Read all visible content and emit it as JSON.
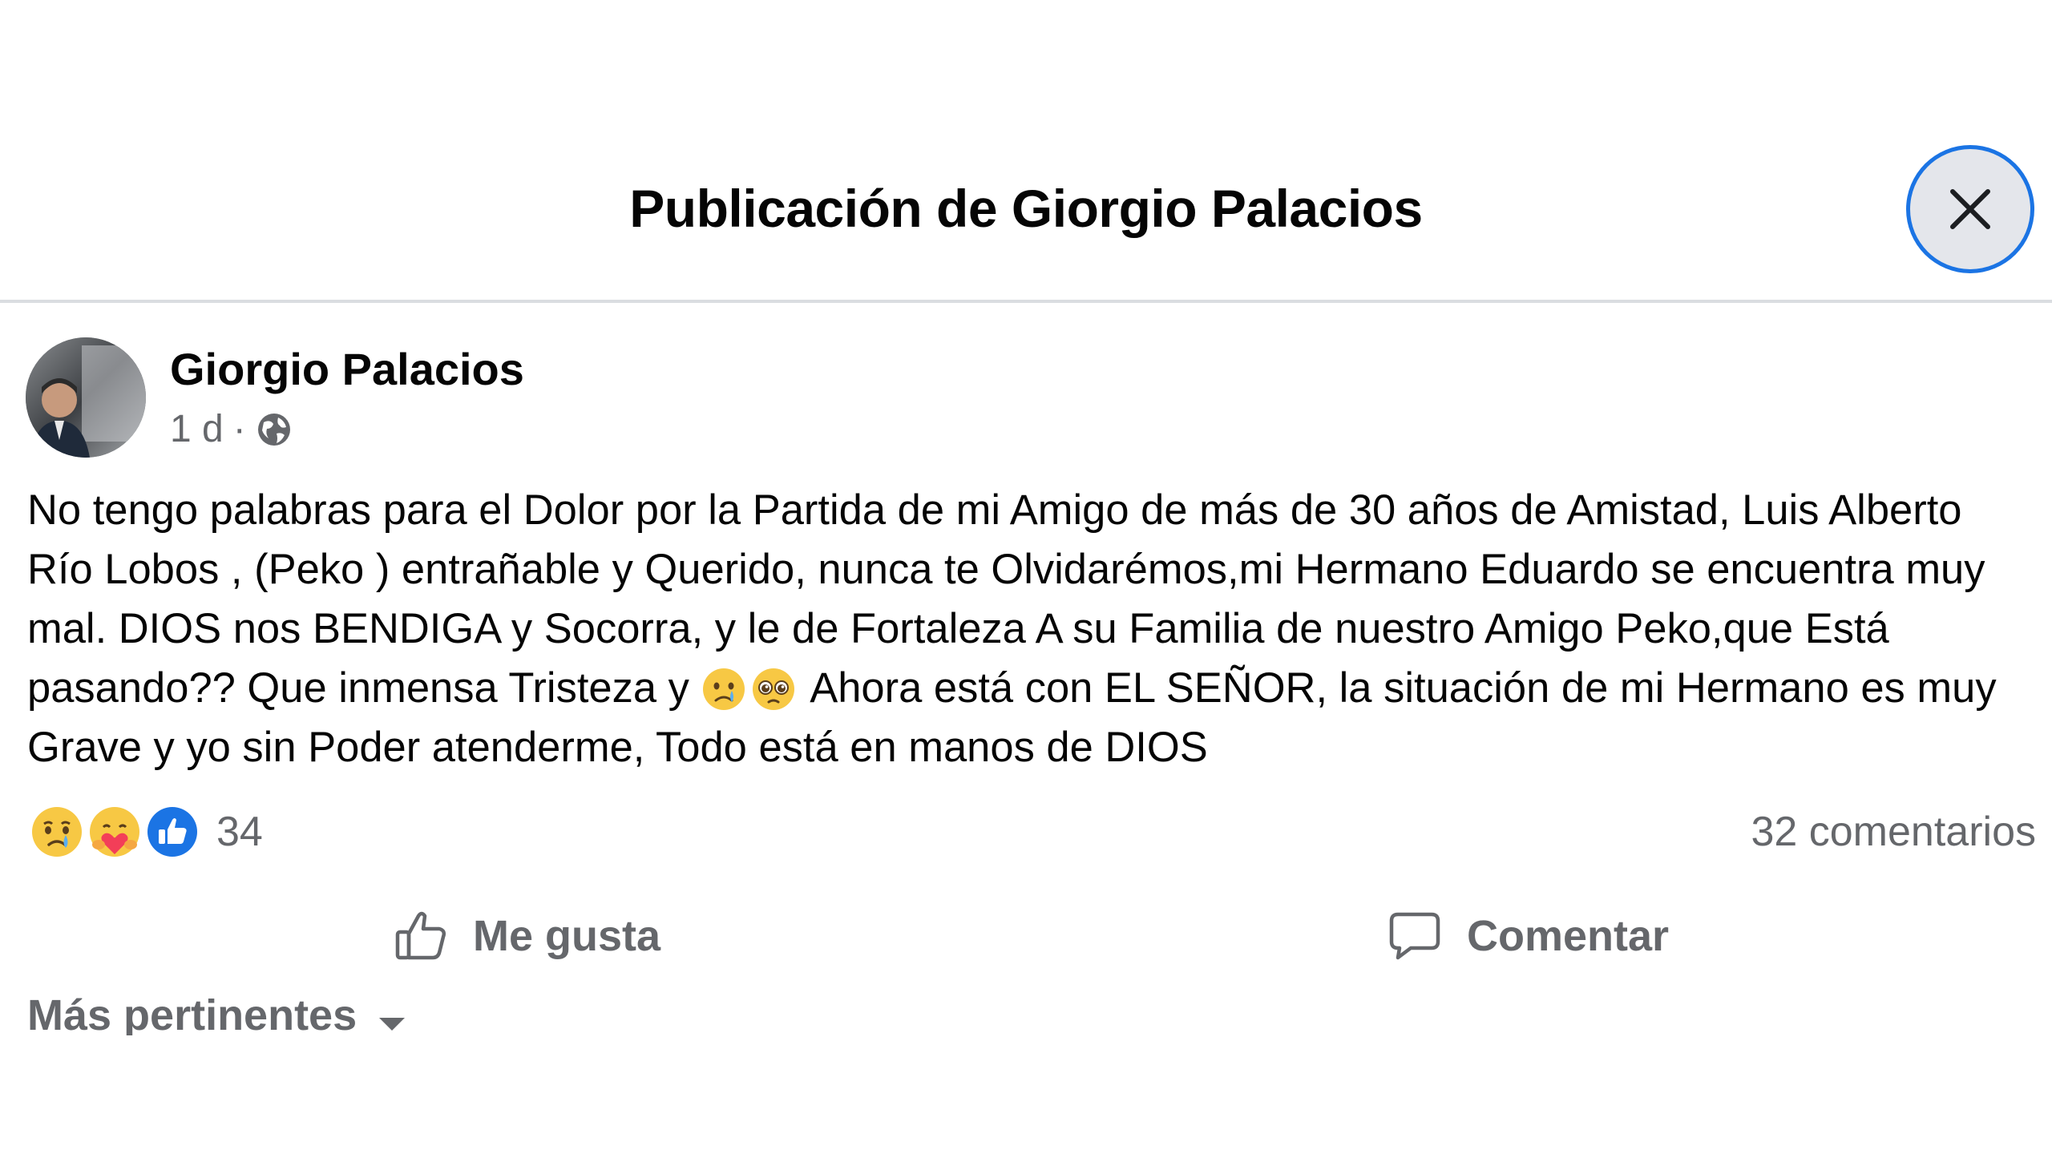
{
  "header": {
    "title": "Publicación de Giorgio Palacios",
    "close_icon": "close-icon"
  },
  "post": {
    "author": "Giorgio Palacios",
    "time": "1 d",
    "separator": "·",
    "audience_icon": "globe-icon",
    "text_part1": "No tengo palabras para el Dolor por la Partida de mi Amigo de más de 30 años de Amistad, Luis Alberto Río Lobos , (Peko ) entrañable y Querido, nunca te Olvidarémos,mi Hermano Eduardo se encuentra muy mal. DIOS nos BENDIGA y Socorra, y le de Fortaleza A su Familia de nuestro Amigo Peko,que Está pasando?? Que inmensa Tristeza y ",
    "text_emojis": [
      "crying-face-emoji",
      "pleading-face-emoji"
    ],
    "text_part2": " Ahora está con EL SEÑOR, la situación de mi Hermano es muy Grave y yo sin Poder atenderme, Todo está en manos de DIOS"
  },
  "reactions": {
    "icons": [
      "sad-reaction-icon",
      "care-reaction-icon",
      "like-reaction-icon"
    ],
    "count": "34",
    "comments": "32 comentarios"
  },
  "actions": {
    "like_label": "Me gusta",
    "comment_label": "Comentar"
  },
  "sort": {
    "label": "Más pertinentes"
  },
  "colors": {
    "accent": "#1b74e4",
    "secondary_text": "#65676b",
    "primary_text": "#050505",
    "divider": "#dadde1"
  }
}
